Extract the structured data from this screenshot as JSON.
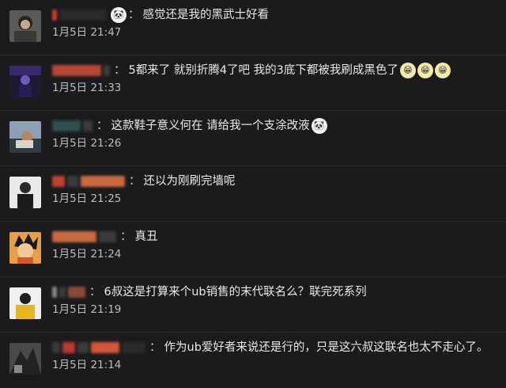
{
  "comments": [
    {
      "username": "",
      "text": "感觉还是我的黑武士好看",
      "emoji": [
        "panda-face-icon"
      ],
      "time": "1月5日 21:47"
    },
    {
      "username": "",
      "text": "5都来了 就别折腾4了吧 我的3底下都被我刷成黑色了",
      "emoji": [
        "grinning-face-icon",
        "grinning-face-icon",
        "grinning-face-icon"
      ],
      "time": "1月5日 21:33"
    },
    {
      "username": "",
      "text": "这款鞋子意义何在 请给我一个支涂改液",
      "emoji": [
        "panda-face-icon"
      ],
      "time": "1月5日 21:26"
    },
    {
      "username": "",
      "text": "还以为刚刷完墙呢",
      "emoji": [],
      "time": "1月5日 21:25"
    },
    {
      "username": "",
      "text": "真丑",
      "emoji": [],
      "time": "1月5日 21:24"
    },
    {
      "username": "",
      "text": "6叔这是打算来个ub销售的末代联名么？联完死系列",
      "emoji": [],
      "time": "1月5日 21:19"
    },
    {
      "username": "",
      "text": "作为ub爱好者来说还是行的，只是这六叔这联名也太不走心了。",
      "emoji": [],
      "time": "1月5日 21:14"
    }
  ],
  "separator": "："
}
